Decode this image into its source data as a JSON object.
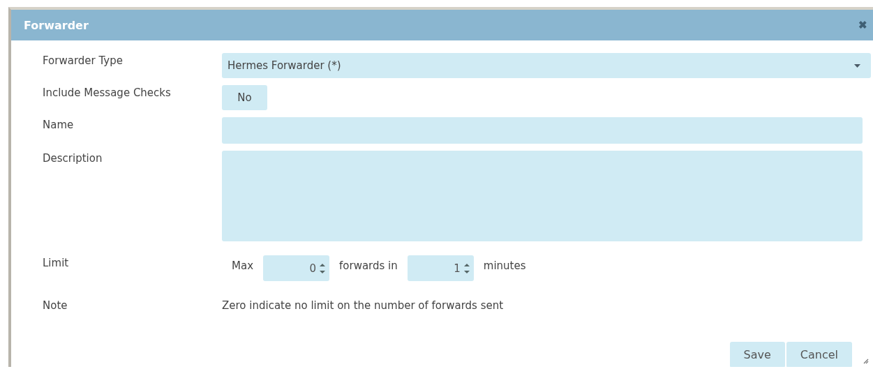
{
  "window": {
    "title": "Forwarder",
    "close": "✖"
  },
  "fields": [
    {
      "kind": "select",
      "label": "Forwarder Type",
      "value": "Hermes Forwarder (*)"
    },
    {
      "kind": "toggle",
      "label": "Include Message Checks",
      "value": "No"
    },
    {
      "kind": "text",
      "label": "Name"
    },
    {
      "kind": "textarea",
      "label": "Description"
    },
    {
      "kind": "limit",
      "label": "Limit",
      "prefix": "Max",
      "count": "0",
      "middle": "forwards in",
      "minutes": "1",
      "suffix": "minutes"
    },
    {
      "kind": "note",
      "label": "Note",
      "text": "Zero indicate no limit on the number of forwards sent"
    }
  ],
  "buttons": [
    "Save",
    "Cancel"
  ]
}
